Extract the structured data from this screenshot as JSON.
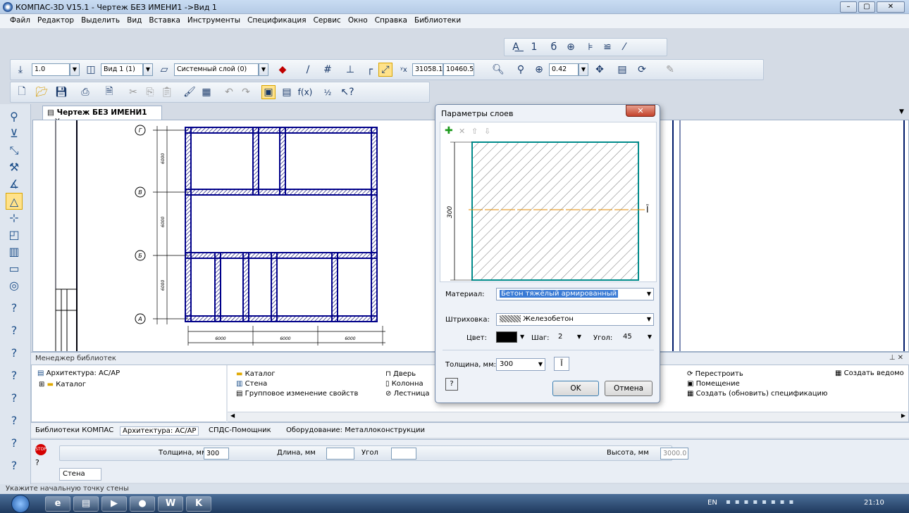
{
  "window": {
    "title": "КОМПАС-3D V15.1 - Чертеж БЕЗ ИМЕНИ1 ->Вид 1"
  },
  "menu": [
    "Файл",
    "Редактор",
    "Выделить",
    "Вид",
    "Вставка",
    "Инструменты",
    "Спецификация",
    "Сервис",
    "Окно",
    "Справка",
    "Библиотеки"
  ],
  "toolbar": {
    "scale": "1.0",
    "view": "Вид 1 (1)",
    "layer": "Системный слой (0)",
    "coord_x": "31058.1",
    "coord_y": "10460.5",
    "zoom": "0.42"
  },
  "document": {
    "tab": "Чертеж БЕЗ ИМЕНИ1",
    "axes": [
      "Г",
      "В",
      "Б",
      "А"
    ],
    "dims_vertical": [
      "6000",
      "6000",
      "6000"
    ],
    "dims_horizontal": [
      "6000",
      "6000",
      "6000"
    ]
  },
  "dialog": {
    "title": "Параметры слоев",
    "thickness_dim": "300",
    "material_label": "Материал:",
    "material_value": "Бетон тяжёлый армированный",
    "hatch_label": "Штриховка:",
    "hatch_value": "Железобетон",
    "color_label": "Цвет:",
    "step_label": "Шаг:",
    "step_value": "2",
    "angle_label": "Угол:",
    "angle_value": "45",
    "thickness_label": "Толщина, мм:",
    "thickness_value": "300",
    "ok": "OK",
    "cancel": "Отмена"
  },
  "library": {
    "header": "Менеджер библиотек",
    "tree_root": "Архитектура: АС/АР",
    "tree_child": "Каталог",
    "col1": [
      "Каталог",
      "Стена",
      "Групповое изменение свойств"
    ],
    "col2": [
      "Дверь",
      "Колонна",
      "Лестница"
    ],
    "col3": [
      "Перестроить",
      "Помещение",
      "Создать (обновить) спецификацию"
    ],
    "col4": [
      "Создать ведомо"
    ],
    "tabs": [
      "Библиотеки КОМПАС",
      "Архитектура: АС/АР",
      "СПДС-Помощник",
      "Оборудование: Металлоконструкции"
    ]
  },
  "properties": {
    "thickness_label": "Толщина, мм",
    "thickness_value": "300",
    "length_label": "Длина, мм",
    "angle_label": "Угол",
    "height_label": "Высота, мм",
    "height_value": "3000.0",
    "wall_tab": "Стена"
  },
  "status": "Укажите начальную точку стены",
  "taskbar": {
    "lang": "EN",
    "time": "21:10"
  }
}
